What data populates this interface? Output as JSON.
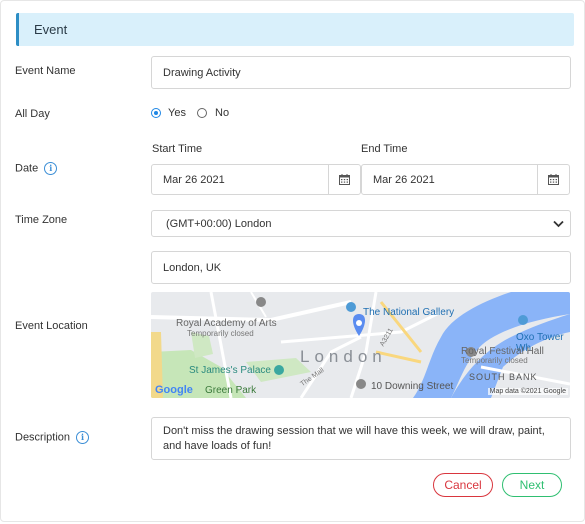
{
  "section": {
    "title": "Event"
  },
  "form": {
    "event_name": {
      "label": "Event Name",
      "value": "Drawing Activity"
    },
    "all_day": {
      "label": "All Day",
      "options": [
        "Yes",
        "No"
      ],
      "selected": "Yes"
    },
    "date": {
      "label": "Date",
      "start_label": "Start Time",
      "start_value": "Mar 26 2021",
      "end_label": "End Time",
      "end_value": "Mar 26 2021"
    },
    "time_zone": {
      "label": "Time Zone",
      "value": "(GMT+00:00) London"
    },
    "location": {
      "label": "Event Location",
      "value": "London, UK",
      "map": {
        "labels": [
          "The National Gallery",
          "Royal Academy of Arts",
          "Temporarily closed",
          "Oxo Tower Wh",
          "London",
          "Royal Festival Hall",
          "Temporarily closed",
          "St James's Palace",
          "SOUTH BANK",
          "Green Park",
          "The Mall",
          "10 Downing Street",
          "A3211"
        ],
        "attribution": "Map data ©2021 Google",
        "logo": "Google"
      }
    },
    "description": {
      "label": "Description",
      "value": "Don't miss the drawing session that we will have this week, we will draw, paint, and have loads of fun!"
    }
  },
  "buttons": {
    "cancel": "Cancel",
    "next": "Next"
  },
  "colors": {
    "accent": "#2d8ec5",
    "header_bg": "#d9f0fb",
    "cancel": "#d9363e",
    "next": "#2fbf71"
  }
}
